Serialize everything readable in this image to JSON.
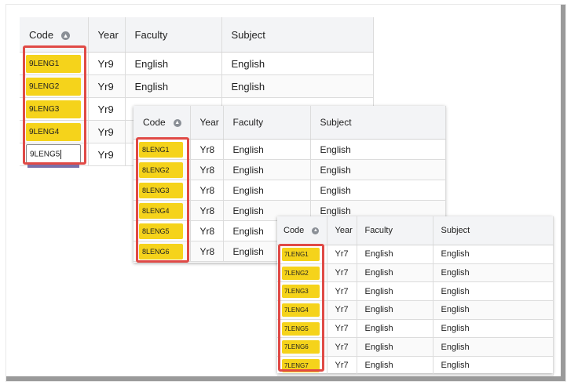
{
  "colors": {
    "highlight": "#f5d31b",
    "selection_border": "#e04a46"
  },
  "tables": [
    {
      "headers": [
        "Code",
        "Year",
        "Faculty",
        "Subject"
      ],
      "sort_icon": "sort-circle-icon",
      "rows": [
        {
          "code": "9LENG1",
          "year": "Yr9",
          "faculty": "English",
          "subject": "English"
        },
        {
          "code": "9LENG2",
          "year": "Yr9",
          "faculty": "English",
          "subject": "English"
        },
        {
          "code": "9LENG3",
          "year": "Yr9",
          "faculty": "",
          "subject": ""
        },
        {
          "code": "9LENG4",
          "year": "Yr9",
          "faculty": "",
          "subject": ""
        },
        {
          "code": "9LENG5",
          "year": "Yr9",
          "faculty": "",
          "subject": ""
        }
      ]
    },
    {
      "headers": [
        "Code",
        "Year",
        "Faculty",
        "Subject"
      ],
      "sort_icon": "sort-circle-icon",
      "rows": [
        {
          "code": "8LENG1",
          "year": "Yr8",
          "faculty": "English",
          "subject": "English"
        },
        {
          "code": "8LENG2",
          "year": "Yr8",
          "faculty": "English",
          "subject": "English"
        },
        {
          "code": "8LENG3",
          "year": "Yr8",
          "faculty": "English",
          "subject": "English"
        },
        {
          "code": "8LENG4",
          "year": "Yr8",
          "faculty": "English",
          "subject": "English"
        },
        {
          "code": "8LENG5",
          "year": "Yr8",
          "faculty": "English",
          "subject": ""
        },
        {
          "code": "8LENG6",
          "year": "Yr8",
          "faculty": "English",
          "subject": ""
        }
      ]
    },
    {
      "headers": [
        "Code",
        "Year",
        "Faculty",
        "Subject"
      ],
      "sort_icon": "sort-circle-icon",
      "rows": [
        {
          "code": "7LENG1",
          "year": "Yr7",
          "faculty": "English",
          "subject": "English"
        },
        {
          "code": "7LENG2",
          "year": "Yr7",
          "faculty": "English",
          "subject": "English"
        },
        {
          "code": "7LENG3",
          "year": "Yr7",
          "faculty": "English",
          "subject": "English"
        },
        {
          "code": "7LENG4",
          "year": "Yr7",
          "faculty": "English",
          "subject": "English"
        },
        {
          "code": "7LENG5",
          "year": "Yr7",
          "faculty": "English",
          "subject": "English"
        },
        {
          "code": "7LENG6",
          "year": "Yr7",
          "faculty": "English",
          "subject": "English"
        },
        {
          "code": "7LENG7",
          "year": "Yr7",
          "faculty": "English",
          "subject": "English"
        }
      ]
    }
  ]
}
